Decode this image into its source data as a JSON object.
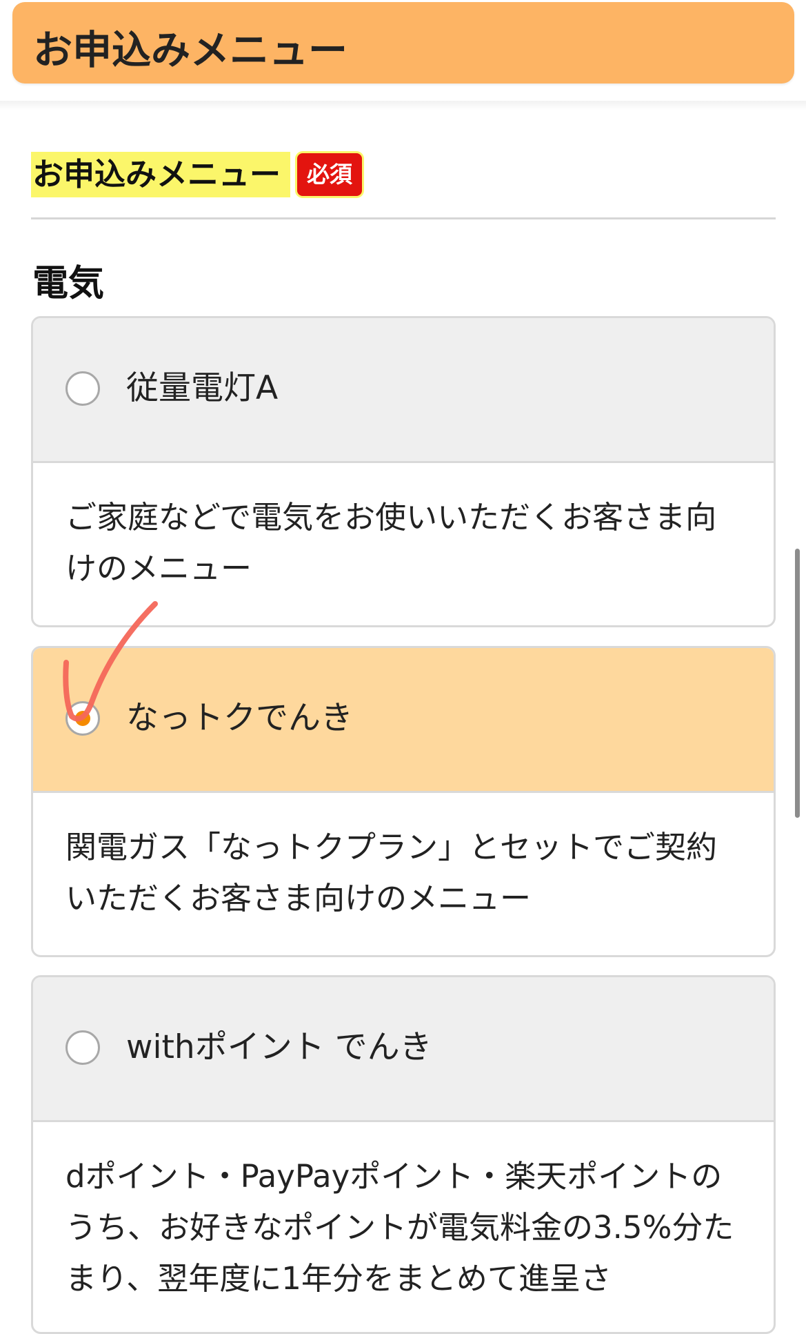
{
  "header": {
    "title": "お申込みメニュー"
  },
  "section": {
    "heading": "お申込みメニュー",
    "required_badge": "必須",
    "category": "電気"
  },
  "options": [
    {
      "label": "従量電灯A",
      "description": "ご家庭などで電気をお使いいただくお客さま向けのメニュー",
      "selected": false
    },
    {
      "label": "なっトクでんき",
      "description": "関電ガス「なっトクプラン」とセットでご契約いただくお客さま向けのメニュー",
      "selected": true
    },
    {
      "label": "withポイント でんき",
      "description": "dポイント・PayPayポイント・楽天ポイントのうち、お好きなポイントが電気料金の3.5%分たまり、翌年度に1年分をまとめて進呈さ",
      "selected": false
    }
  ],
  "colors": {
    "header_bg": "#fdb464",
    "highlight": "#fbf66a",
    "badge_bg": "#e3140f",
    "selected_bg": "#fed89d",
    "radio_dot": "#f58a00",
    "annotation_check": "#f4675a"
  }
}
